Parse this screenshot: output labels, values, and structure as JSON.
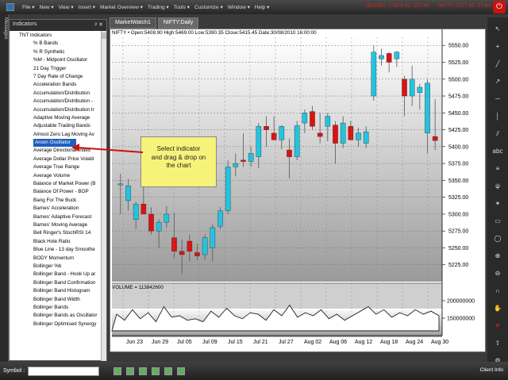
{
  "menu": {
    "items": [
      "File ▾",
      "New ▾",
      "View ▾",
      "Insert ▾",
      "Market Overview ▾",
      "Trading ▾",
      "Tools ▾",
      "Customize ▾",
      "Window ▾",
      "Help ▾"
    ],
    "ticker": {
      "sensex": "SENSEX: 17874.15 -157.96",
      "nifty": "NIFTY: 5377.85 -37.60"
    }
  },
  "messages_label": "Messages",
  "panel": {
    "title": "Indicators",
    "controls": "ᵖ ✕",
    "root": "TNT Indicators",
    "items": [
      "% B Bands",
      "% R Synthetic",
      "%M - Midpoint Oscillator",
      "21 Day Trigger",
      "7 Day Rate of Change",
      "Acceleration Bands",
      "Accumulation/Distribution",
      "Accumulation/Distribution -",
      "Accumulation/Distribution Ir",
      "Adaptive Moving Average",
      "Adjustable Trading Bands",
      "Almost Zero Lag Moving Av",
      "Aroon Oscillator",
      "Average Directional Index",
      "Average Dollar Price Volatil",
      "Average True Range",
      "Average Volume",
      "Balance of Market Power (B",
      "Balance Of Power - BOP",
      "Bang For The Buck",
      "Barnes' Acceleration",
      "Barnes' Adaptive Forecast",
      "Barnes' Moving Average",
      "Bell Ringer's StochRSI 14",
      "Black Hole Ratio",
      "Blue Line - 13 day Smoothe",
      "BODY Momentum",
      "Bollinger %b",
      "Bollinger Band - Hook Up ar",
      "Bollinger Band Confirmation",
      "Bollinger Band Histogram",
      "Bollinger Band Width",
      "Bollinger Bands",
      "Bollinger Bands as Oscillator",
      "Bollinger Optimised Synergy"
    ],
    "selected_index": 12
  },
  "tabs": [
    {
      "label": "MarketWatch1",
      "active": false
    },
    {
      "label": "NIFTY:Daily",
      "active": true
    }
  ],
  "chart_header": "NIFTY • Open:5408.90 High:5469.00 Low:5390.35 Close:5415.45 Date:30/08/2010 16:00:00",
  "volume_label": "VOLUME = 113842600",
  "callout_lines": [
    "Select indicator",
    "and drag & drop on",
    "the chart"
  ],
  "colors": {
    "up": "#22c4e0",
    "down": "#dd1111",
    "callout": "#f7f37a",
    "selection": "#1f5fbf",
    "arrow": "#cc1111"
  },
  "right_toolbar_icons": [
    "arrow-icon",
    "crosshair-icon",
    "line-icon",
    "ray-icon",
    "hline-icon",
    "vline-icon",
    "channel-icon",
    "text-icon",
    "fib-icon",
    "pitchfork-icon",
    "gann-icon",
    "rect-icon",
    "ellipse-icon",
    "zoom-in-icon",
    "zoom-out-icon",
    "magnet-icon",
    "pan-icon",
    "delete-icon",
    "arrow-up-icon",
    "settings-icon"
  ],
  "statusbar": {
    "symbol_label": "Symbol :",
    "client_info": "Client Info"
  },
  "chart_data": {
    "type": "candlestick",
    "price_axis": {
      "min": 5200,
      "max": 5562,
      "ticks": [
        5550,
        5525,
        5500,
        5475,
        5450,
        5425,
        5400,
        5375,
        5350,
        5325,
        5300,
        5275,
        5250,
        5225
      ]
    },
    "date_ticks": [
      "Jun 23",
      "Jun 29",
      "Jul 05",
      "Jul 09",
      "Jul 15",
      "Jul 21",
      "Jul 27",
      "Aug 02",
      "Aug 06",
      "Aug 12",
      "Aug 18",
      "Aug 24",
      "Aug 30"
    ],
    "candles": [
      {
        "o": 5344,
        "h": 5360,
        "l": 5300,
        "c": 5345
      },
      {
        "o": 5320,
        "h": 5352,
        "l": 5305,
        "c": 5342
      },
      {
        "o": 5292,
        "h": 5318,
        "l": 5278,
        "c": 5315
      },
      {
        "o": 5315,
        "h": 5340,
        "l": 5300,
        "c": 5300
      },
      {
        "o": 5300,
        "h": 5310,
        "l": 5270,
        "c": 5275
      },
      {
        "o": 5275,
        "h": 5292,
        "l": 5250,
        "c": 5288
      },
      {
        "o": 5288,
        "h": 5312,
        "l": 5280,
        "c": 5300
      },
      {
        "o": 5265,
        "h": 5302,
        "l": 5235,
        "c": 5245
      },
      {
        "o": 5245,
        "h": 5262,
        "l": 5212,
        "c": 5240
      },
      {
        "o": 5260,
        "h": 5270,
        "l": 5230,
        "c": 5245
      },
      {
        "o": 5243,
        "h": 5256,
        "l": 5232,
        "c": 5238
      },
      {
        "o": 5240,
        "h": 5270,
        "l": 5232,
        "c": 5265
      },
      {
        "o": 5250,
        "h": 5285,
        "l": 5230,
        "c": 5280
      },
      {
        "o": 5282,
        "h": 5310,
        "l": 5278,
        "c": 5305
      },
      {
        "o": 5305,
        "h": 5380,
        "l": 5300,
        "c": 5370
      },
      {
        "o": 5370,
        "h": 5390,
        "l": 5356,
        "c": 5375
      },
      {
        "o": 5380,
        "h": 5420,
        "l": 5370,
        "c": 5378
      },
      {
        "o": 5378,
        "h": 5400,
        "l": 5370,
        "c": 5390
      },
      {
        "o": 5385,
        "h": 5435,
        "l": 5368,
        "c": 5430
      },
      {
        "o": 5430,
        "h": 5445,
        "l": 5400,
        "c": 5425
      },
      {
        "o": 5420,
        "h": 5445,
        "l": 5410,
        "c": 5410
      },
      {
        "o": 5410,
        "h": 5432,
        "l": 5396,
        "c": 5430
      },
      {
        "o": 5395,
        "h": 5412,
        "l": 5353,
        "c": 5385
      },
      {
        "o": 5385,
        "h": 5438,
        "l": 5380,
        "c": 5431
      },
      {
        "o": 5435,
        "h": 5455,
        "l": 5420,
        "c": 5450
      },
      {
        "o": 5452,
        "h": 5460,
        "l": 5425,
        "c": 5430
      },
      {
        "o": 5420,
        "h": 5450,
        "l": 5405,
        "c": 5415
      },
      {
        "o": 5430,
        "h": 5450,
        "l": 5408,
        "c": 5445
      },
      {
        "o": 5432,
        "h": 5438,
        "l": 5375,
        "c": 5405
      },
      {
        "o": 5405,
        "h": 5445,
        "l": 5398,
        "c": 5435
      },
      {
        "o": 5430,
        "h": 5438,
        "l": 5410,
        "c": 5410
      },
      {
        "o": 5410,
        "h": 5428,
        "l": 5400,
        "c": 5420
      },
      {
        "o": 5405,
        "h": 5430,
        "l": 5398,
        "c": 5422
      },
      {
        "o": 5475,
        "h": 5550,
        "l": 5468,
        "c": 5540
      },
      {
        "o": 5530,
        "h": 5545,
        "l": 5520,
        "c": 5535
      },
      {
        "o": 5538,
        "h": 5540,
        "l": 5510,
        "c": 5525
      },
      {
        "o": 5530,
        "h": 5542,
        "l": 5518,
        "c": 5540
      },
      {
        "o": 5500,
        "h": 5505,
        "l": 5445,
        "c": 5475
      },
      {
        "o": 5475,
        "h": 5520,
        "l": 5460,
        "c": 5500
      },
      {
        "o": 5480,
        "h": 5493,
        "l": 5455,
        "c": 5488
      },
      {
        "o": 5420,
        "h": 5500,
        "l": 5390,
        "c": 5494
      },
      {
        "o": 5415,
        "h": 5470,
        "l": 5395,
        "c": 5409
      }
    ],
    "volume_axis": {
      "ticks": [
        200000000,
        150000000
      ]
    },
    "volume": [
      0.55,
      0.35,
      0.7,
      0.4,
      0.6,
      0.3,
      0.8,
      0.45,
      0.5,
      0.35,
      0.4,
      0.3,
      0.65,
      0.45,
      0.75,
      0.5,
      0.4,
      0.6,
      0.55,
      0.35,
      0.7,
      0.5,
      0.85,
      0.45,
      0.6,
      0.5,
      0.7,
      0.4,
      0.55,
      0.35,
      0.5,
      0.65,
      0.8,
      0.55,
      0.7,
      0.45,
      0.6,
      0.5,
      0.7,
      0.55,
      0.65,
      0.5
    ]
  }
}
